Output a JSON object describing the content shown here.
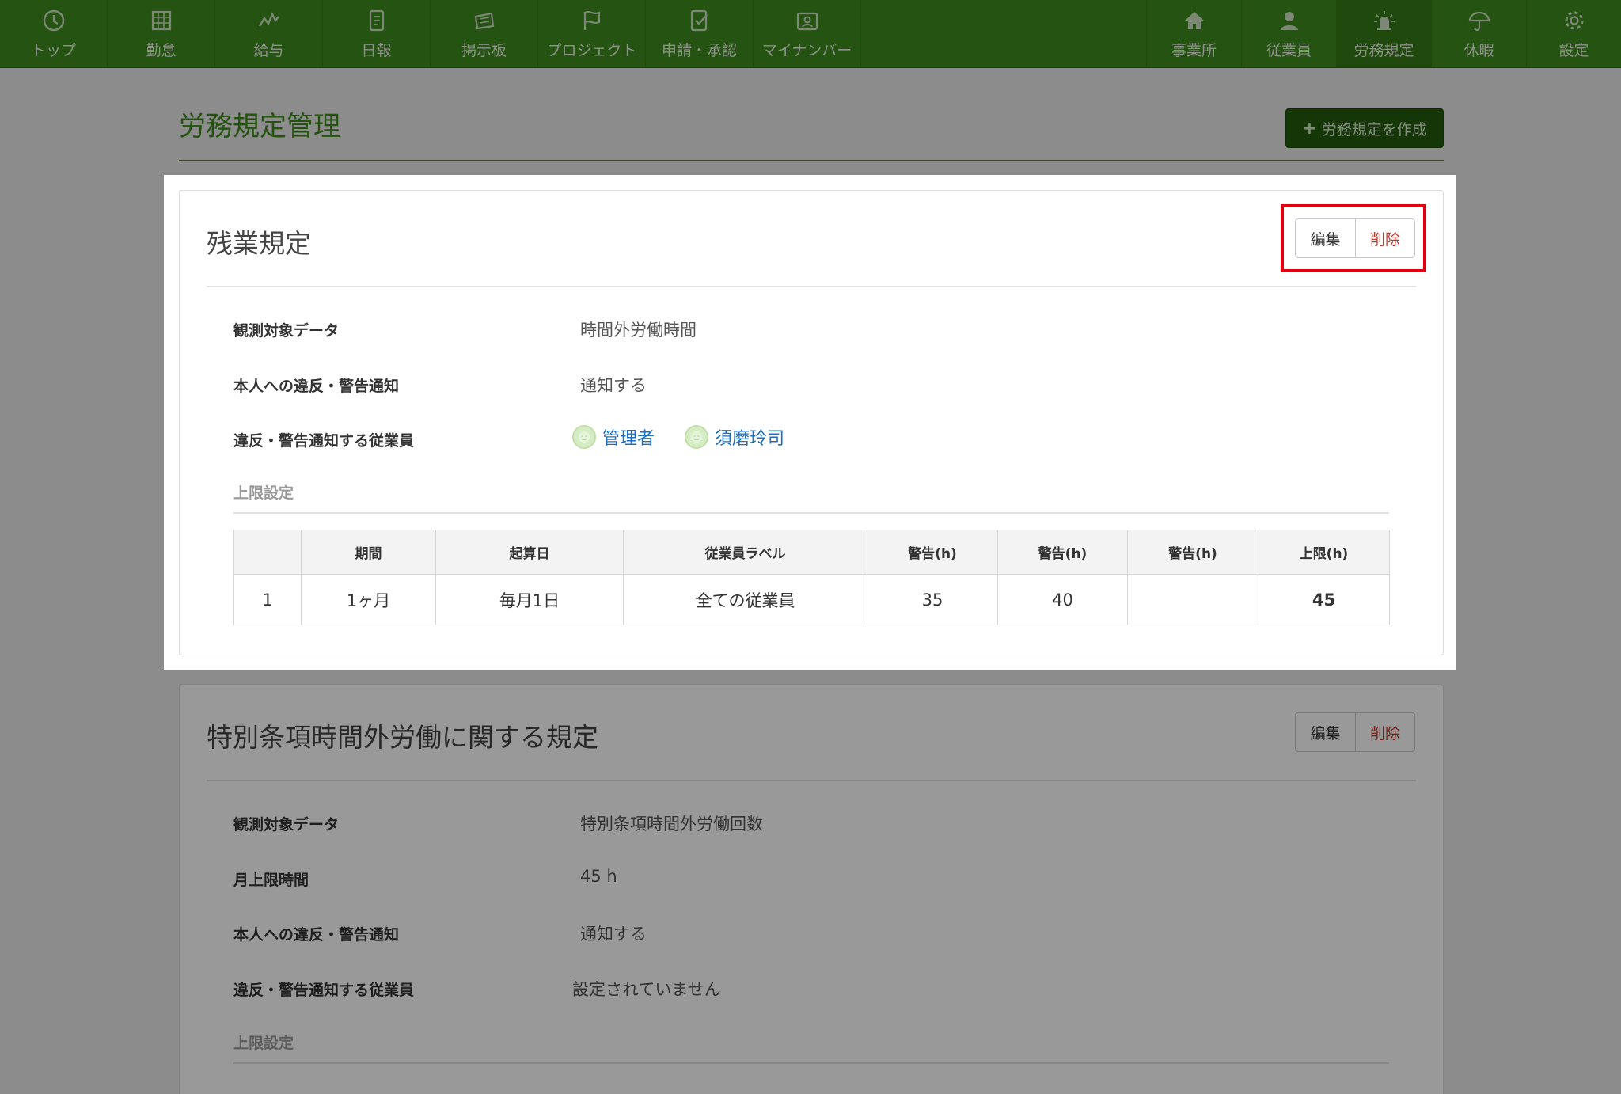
{
  "nav": {
    "left": [
      {
        "label": "トップ",
        "icon": "clock-icon"
      },
      {
        "label": "勤怠",
        "icon": "calendar-icon"
      },
      {
        "label": "給与",
        "icon": "chart-icon"
      },
      {
        "label": "日報",
        "icon": "report-icon"
      },
      {
        "label": "掲示板",
        "icon": "board-icon"
      },
      {
        "label": "プロジェクト",
        "icon": "flag-icon"
      },
      {
        "label": "申請・承認",
        "icon": "approve-icon"
      },
      {
        "label": "マイナンバー",
        "icon": "id-card-icon"
      }
    ],
    "right": [
      {
        "label": "事業所",
        "icon": "home-icon"
      },
      {
        "label": "従業員",
        "icon": "user-icon"
      },
      {
        "label": "労務規定",
        "icon": "alarm-icon",
        "active": true
      },
      {
        "label": "休暇",
        "icon": "umbrella-icon"
      },
      {
        "label": "設定",
        "icon": "gear-icon"
      }
    ]
  },
  "page": {
    "title": "労務規定管理",
    "create_label": "労務規定を作成"
  },
  "panel1": {
    "title": "残業規定",
    "edit_label": "編集",
    "delete_label": "削除",
    "rows": [
      {
        "label": "観測対象データ",
        "value": "時間外労働時間"
      },
      {
        "label": "本人への違反・警告通知",
        "value": "通知する"
      }
    ],
    "notify_label": "違反・警告通知する従業員",
    "notify_users": [
      "管理者",
      "須磨玲司"
    ],
    "limit_section": "上限設定",
    "table": {
      "headers": [
        "",
        "期間",
        "起算日",
        "従業員ラベル",
        "警告(h)",
        "警告(h)",
        "警告(h)",
        "上限(h)"
      ],
      "rows": [
        [
          "1",
          "1ヶ月",
          "毎月1日",
          "全ての従業員",
          "35",
          "40",
          "",
          "45"
        ]
      ]
    }
  },
  "panel2": {
    "title": "特別条項時間外労働に関する規定",
    "edit_label": "編集",
    "delete_label": "削除",
    "rows": [
      {
        "label": "観測対象データ",
        "value": "特別条項時間外労働回数"
      },
      {
        "label": "月上限時間",
        "value": "45 h"
      },
      {
        "label": "本人への違反・警告通知",
        "value": "通知する"
      },
      {
        "label": "違反・警告通知する従業員",
        "value": "設定されていません"
      }
    ],
    "limit_section": "上限設定"
  },
  "colors": {
    "nav_bg": "#3f8a1e",
    "accent": "#3c8a1a",
    "create_btn": "#235c0c",
    "delete_text": "#c0392b",
    "link": "#1a6fc2",
    "highlight": "#e0000f"
  }
}
